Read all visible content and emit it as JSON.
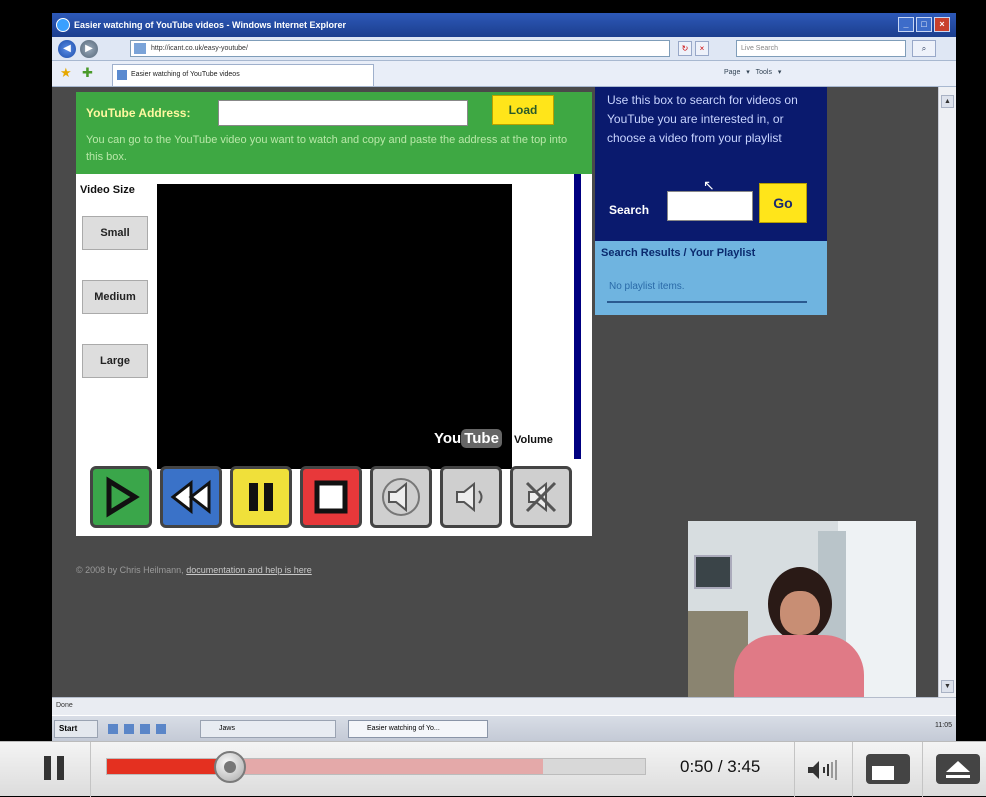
{
  "window": {
    "title": "Easier watching of YouTube videos - Windows Internet Explorer",
    "address": "http://icant.co.uk/easy-youtube/",
    "live_search_placeholder": "Live Search",
    "tab_label": "Easier watching of YouTube videos",
    "toolbar_tools": "Page ▾  Tools ▾",
    "status": "Done"
  },
  "page": {
    "youtube_address_label": "YouTube Address:",
    "load_label": "Load",
    "help_text": "You can go to the YouTube video you want to watch and copy and paste the address at the top into this box.",
    "video_size_label": "Video Size",
    "size_buttons": [
      "Small",
      "Medium",
      "Large"
    ],
    "youtube_logo": [
      "You",
      "Tube"
    ],
    "volume_label": "Volume",
    "footer_text": "© 2008 by Chris Heilmann,",
    "footer_link": "documentation and help is here",
    "search_help": "Use this box to search for videos on YouTube you are interested in, or choose a video from your playlist",
    "search_label": "Search",
    "go_label": "Go",
    "results_title": "Search Results / Your Playlist",
    "no_items": "No playlist items."
  },
  "taskbar": {
    "start": "Start",
    "item1": "Jaws",
    "item2": "Easier watching of Yo...",
    "clock": "11:05"
  },
  "player": {
    "current_time": "0:50",
    "duration": "3:45",
    "played_fraction": 0.229,
    "buffered_fraction": 0.81
  }
}
